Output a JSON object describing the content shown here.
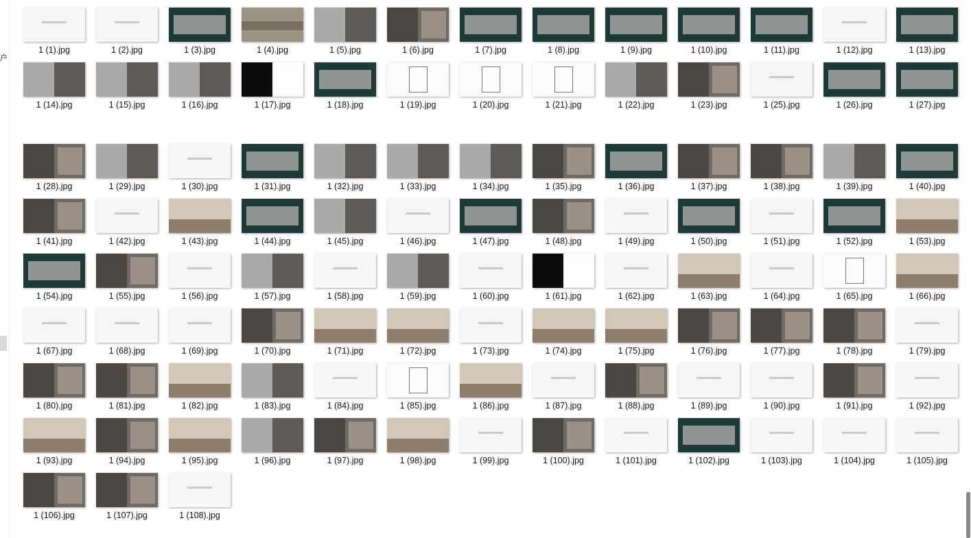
{
  "explorer": {
    "left_fragment": "户",
    "files": [
      {
        "name": "1 (1).jpg",
        "style": "white"
      },
      {
        "name": "1 (2).jpg",
        "style": "white"
      },
      {
        "name": "1 (3).jpg",
        "style": "green"
      },
      {
        "name": "1 (4).jpg",
        "style": "stone"
      },
      {
        "name": "1 (5).jpg",
        "style": "gray"
      },
      {
        "name": "1 (6).jpg",
        "style": "photo"
      },
      {
        "name": "1 (7).jpg",
        "style": "green"
      },
      {
        "name": "1 (8).jpg",
        "style": "green"
      },
      {
        "name": "1 (9).jpg",
        "style": "green"
      },
      {
        "name": "1 (10).jpg",
        "style": "green"
      },
      {
        "name": "1 (11).jpg",
        "style": "green"
      },
      {
        "name": "1 (12).jpg",
        "style": "white"
      },
      {
        "name": "1 (13).jpg",
        "style": "green"
      },
      {
        "name": "1 (14).jpg",
        "style": "gray"
      },
      {
        "name": "1 (15).jpg",
        "style": "gray"
      },
      {
        "name": "1 (16).jpg",
        "style": "gray"
      },
      {
        "name": "1 (17).jpg",
        "style": "black"
      },
      {
        "name": "1 (18).jpg",
        "style": "green"
      },
      {
        "name": "1 (19).jpg",
        "style": "plan"
      },
      {
        "name": "1 (20).jpg",
        "style": "plan"
      },
      {
        "name": "1 (21).jpg",
        "style": "plan"
      },
      {
        "name": "1 (22).jpg",
        "style": "gray"
      },
      {
        "name": "1 (23).jpg",
        "style": "photo"
      },
      {
        "name": "1 (25).jpg",
        "style": "white"
      },
      {
        "name": "1 (26).jpg",
        "style": "green"
      },
      {
        "name": "1 (27).jpg",
        "style": "green"
      },
      {
        "name": "1 (28).jpg",
        "style": "photo"
      },
      {
        "name": "1 (29).jpg",
        "style": "gray"
      },
      {
        "name": "1 (30).jpg",
        "style": "white"
      },
      {
        "name": "1 (31).jpg",
        "style": "green"
      },
      {
        "name": "1 (32).jpg",
        "style": "gray"
      },
      {
        "name": "1 (33).jpg",
        "style": "gray"
      },
      {
        "name": "1 (34).jpg",
        "style": "gray"
      },
      {
        "name": "1 (35).jpg",
        "style": "photo"
      },
      {
        "name": "1 (36).jpg",
        "style": "green"
      },
      {
        "name": "1 (37).jpg",
        "style": "photo"
      },
      {
        "name": "1 (38).jpg",
        "style": "photo"
      },
      {
        "name": "1 (39).jpg",
        "style": "gray"
      },
      {
        "name": "1 (40).jpg",
        "style": "green"
      },
      {
        "name": "1 (41).jpg",
        "style": "photo"
      },
      {
        "name": "1 (42).jpg",
        "style": "white"
      },
      {
        "name": "1 (43).jpg",
        "style": "beige"
      },
      {
        "name": "1 (44).jpg",
        "style": "green"
      },
      {
        "name": "1 (45).jpg",
        "style": "gray"
      },
      {
        "name": "1 (46).jpg",
        "style": "white"
      },
      {
        "name": "1 (47).jpg",
        "style": "green"
      },
      {
        "name": "1 (48).jpg",
        "style": "photo"
      },
      {
        "name": "1 (49).jpg",
        "style": "white"
      },
      {
        "name": "1 (50).jpg",
        "style": "green"
      },
      {
        "name": "1 (51).jpg",
        "style": "white"
      },
      {
        "name": "1 (52).jpg",
        "style": "green"
      },
      {
        "name": "1 (53).jpg",
        "style": "beige"
      },
      {
        "name": "1 (54).jpg",
        "style": "green"
      },
      {
        "name": "1 (55).jpg",
        "style": "photo"
      },
      {
        "name": "1 (56).jpg",
        "style": "white"
      },
      {
        "name": "1 (57).jpg",
        "style": "gray"
      },
      {
        "name": "1 (58).jpg",
        "style": "white"
      },
      {
        "name": "1 (59).jpg",
        "style": "gray"
      },
      {
        "name": "1 (60).jpg",
        "style": "white"
      },
      {
        "name": "1 (61).jpg",
        "style": "black"
      },
      {
        "name": "1 (62).jpg",
        "style": "white"
      },
      {
        "name": "1 (63).jpg",
        "style": "beige"
      },
      {
        "name": "1 (64).jpg",
        "style": "white"
      },
      {
        "name": "1 (65).jpg",
        "style": "plan"
      },
      {
        "name": "1 (66).jpg",
        "style": "beige"
      },
      {
        "name": "1 (67).jpg",
        "style": "white"
      },
      {
        "name": "1 (68).jpg",
        "style": "white"
      },
      {
        "name": "1 (69).jpg",
        "style": "white"
      },
      {
        "name": "1 (70).jpg",
        "style": "photo"
      },
      {
        "name": "1 (71).jpg",
        "style": "beige"
      },
      {
        "name": "1 (72).jpg",
        "style": "beige"
      },
      {
        "name": "1 (73).jpg",
        "style": "white"
      },
      {
        "name": "1 (74).jpg",
        "style": "beige"
      },
      {
        "name": "1 (75).jpg",
        "style": "beige"
      },
      {
        "name": "1 (76).jpg",
        "style": "photo"
      },
      {
        "name": "1 (77).jpg",
        "style": "photo"
      },
      {
        "name": "1 (78).jpg",
        "style": "photo"
      },
      {
        "name": "1 (79).jpg",
        "style": "white"
      },
      {
        "name": "1 (80).jpg",
        "style": "photo"
      },
      {
        "name": "1 (81).jpg",
        "style": "photo"
      },
      {
        "name": "1 (82).jpg",
        "style": "beige"
      },
      {
        "name": "1 (83).jpg",
        "style": "gray"
      },
      {
        "name": "1 (84).jpg",
        "style": "white"
      },
      {
        "name": "1 (85).jpg",
        "style": "plan"
      },
      {
        "name": "1 (86).jpg",
        "style": "beige"
      },
      {
        "name": "1 (87).jpg",
        "style": "white"
      },
      {
        "name": "1 (88).jpg",
        "style": "photo"
      },
      {
        "name": "1 (89).jpg",
        "style": "white"
      },
      {
        "name": "1 (90).jpg",
        "style": "white"
      },
      {
        "name": "1 (91).jpg",
        "style": "photo"
      },
      {
        "name": "1 (92).jpg",
        "style": "white"
      },
      {
        "name": "1 (93).jpg",
        "style": "beige"
      },
      {
        "name": "1 (94).jpg",
        "style": "photo"
      },
      {
        "name": "1 (95).jpg",
        "style": "beige"
      },
      {
        "name": "1 (96).jpg",
        "style": "gray"
      },
      {
        "name": "1 (97).jpg",
        "style": "photo"
      },
      {
        "name": "1 (98).jpg",
        "style": "beige"
      },
      {
        "name": "1 (99).jpg",
        "style": "white"
      },
      {
        "name": "1 (100).jpg",
        "style": "photo"
      },
      {
        "name": "1 (101).jpg",
        "style": "white"
      },
      {
        "name": "1 (102).jpg",
        "style": "green"
      },
      {
        "name": "1 (103).jpg",
        "style": "white"
      },
      {
        "name": "1 (104).jpg",
        "style": "white"
      },
      {
        "name": "1 (105).jpg",
        "style": "white"
      },
      {
        "name": "1 (106).jpg",
        "style": "photo"
      },
      {
        "name": "1 (107).jpg",
        "style": "photo"
      },
      {
        "name": "1 (108).jpg",
        "style": "white"
      }
    ]
  },
  "colors": {
    "green": "#1d3a38",
    "stone": "#9c9584",
    "gray": "#a9a9a9",
    "photo": "#6f6a63",
    "white": "#f6f6f6",
    "black": "#0c0c0c",
    "plan": "#fbfbfb",
    "beige": "#d3c8b8"
  }
}
